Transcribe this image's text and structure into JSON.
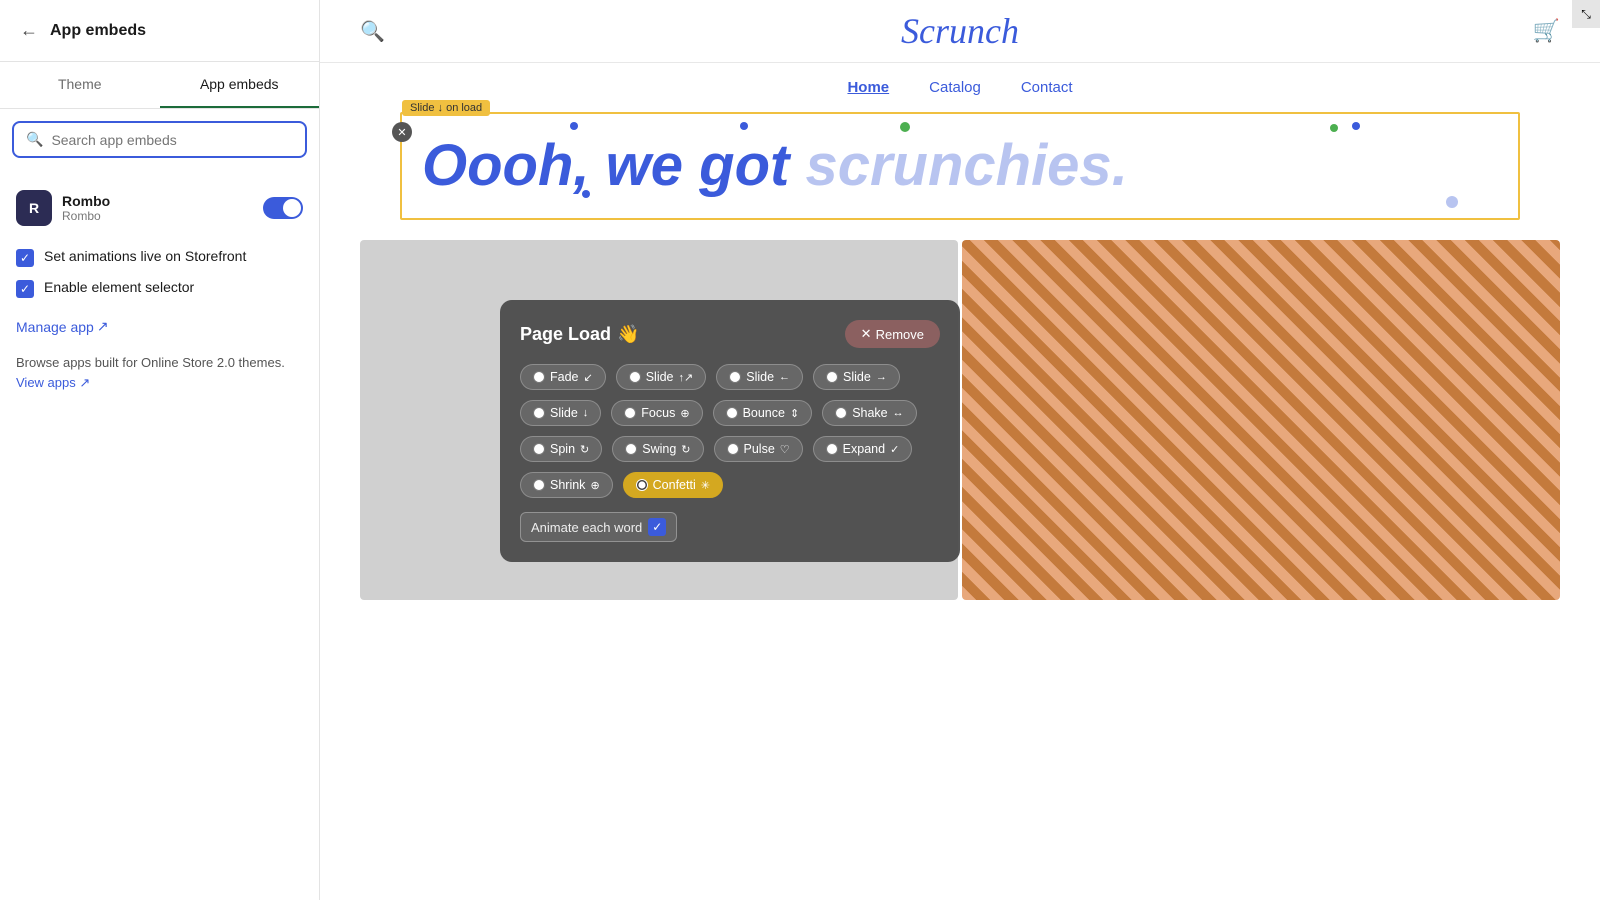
{
  "sidebar": {
    "title": "App embeds",
    "back_label": "‹",
    "tabs": [
      {
        "id": "theme",
        "label": "Theme"
      },
      {
        "id": "app_embeds",
        "label": "App embeds"
      }
    ],
    "search_placeholder": "Search app embeds",
    "app": {
      "name": "Rombo",
      "sub": "Rombo",
      "icon_letter": "R"
    },
    "checkboxes": [
      {
        "label": "Set animations live on Storefront",
        "checked": true
      },
      {
        "label": "Enable element selector",
        "checked": true
      }
    ],
    "manage_link": "Manage app",
    "browse_text": "Browse apps built for Online Store 2.0 themes.",
    "view_link": "View apps"
  },
  "storefront": {
    "logo": "Scrunch",
    "nav": [
      {
        "label": "Home",
        "active": true
      },
      {
        "label": "Catalog",
        "active": false
      },
      {
        "label": "Contact",
        "active": false
      }
    ],
    "hero_text": "Oooh, we got scrunchies.",
    "slide_tag": "Slide ↓ on load"
  },
  "animation_panel": {
    "title": "Page Load",
    "emoji": "👋",
    "remove_label": "Remove",
    "options_row1": [
      {
        "label": "Fade↙",
        "selected": false
      },
      {
        "label": "Slide↑↗",
        "selected": false
      },
      {
        "label": "Slide←",
        "selected": false
      },
      {
        "label": "Slide→",
        "selected": false
      }
    ],
    "options_row2": [
      {
        "label": "Slide↓",
        "selected": false
      },
      {
        "label": "Focus⊕",
        "selected": false
      },
      {
        "label": "Bounce⇕",
        "selected": false
      },
      {
        "label": "Shake↔",
        "selected": false
      }
    ],
    "options_row3": [
      {
        "label": "Spin↻",
        "selected": false
      },
      {
        "label": "Swing↻",
        "selected": false
      },
      {
        "label": "Pulse♡",
        "selected": false
      },
      {
        "label": "Expand✓",
        "selected": false
      }
    ],
    "options_row4": [
      {
        "label": "Shrink⊕",
        "selected": false
      },
      {
        "label": "Confetti✳",
        "selected": true
      }
    ],
    "animate_each_word": "Animate each word",
    "animate_each_word_checked": true
  }
}
